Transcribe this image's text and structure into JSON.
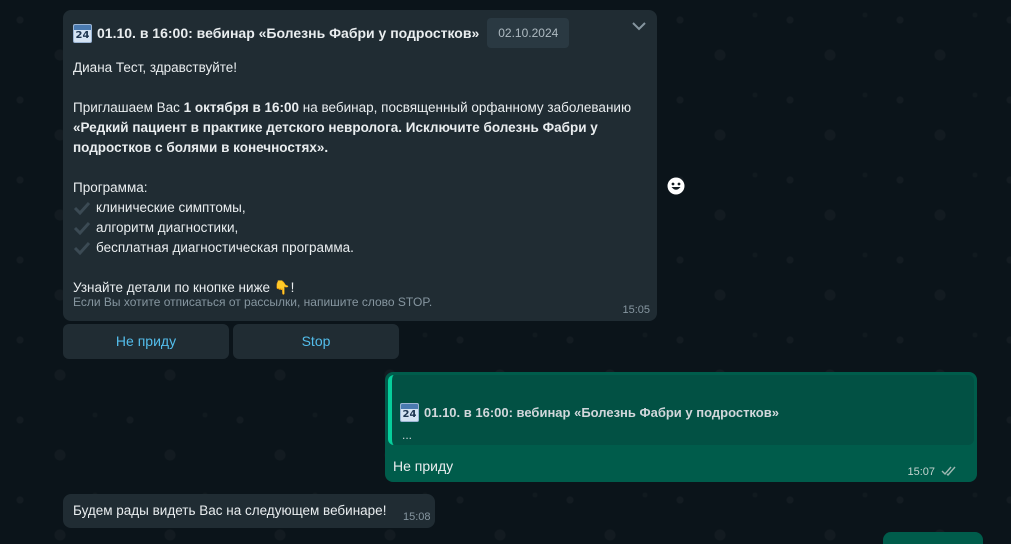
{
  "incoming_message": {
    "header": {
      "calendar_icon_number": "24",
      "title": "01.10. в 16:00: вебинар «Болезнь Фабри у подростков»",
      "date_badge": "02.10.2024"
    },
    "greeting": "Диана Тест, здравствуйте!",
    "invite": {
      "part1": "Приглашаем Вас ",
      "bold1": "1 октября в 16:00",
      "part2": " на вебинар, посвященный орфанному заболеванию ",
      "bold2": "«Редкий пациент в практике детского невролога. Исключите болезнь Фабри у подростков с болями в конечностях»."
    },
    "program_heading": "Программа:",
    "program_items": [
      "клинические  симптомы,",
      "алгоритм диагностики,",
      "бесплатная диагностическая программа."
    ],
    "cta": "Узнайте детали по кнопке ниже ",
    "cta_emoji": "👇",
    "cta_end": "!",
    "unsubscribe_note": "Если Вы хотите отписаться от рассылки, напишите слово STOP.",
    "time": "15:05"
  },
  "quick_replies": [
    "Не приду",
    "Stop"
  ],
  "outgoing_message": {
    "quote_title": "01.10. в 16:00: вебинар «Болезнь Фабри у подростков»",
    "quote_icon_number": "24",
    "quote_ellipsis": "...",
    "text": "Не приду",
    "time": "15:07"
  },
  "incoming_message_2": {
    "text": "Будем рады видеть Вас на следующем вебинаре!",
    "time": "15:08"
  },
  "icons": [
    "calendar-icon",
    "chevron-down-icon",
    "emoji-reaction-icon",
    "check-icon",
    "double-check-icon"
  ],
  "colors": {
    "background": "#0b141a",
    "incoming_bubble": "#202c33",
    "outgoing_bubble": "#005c4b",
    "quote_bar": "#06cf9c",
    "button_text": "#53bdeb",
    "muted_text": "#8696a0"
  }
}
